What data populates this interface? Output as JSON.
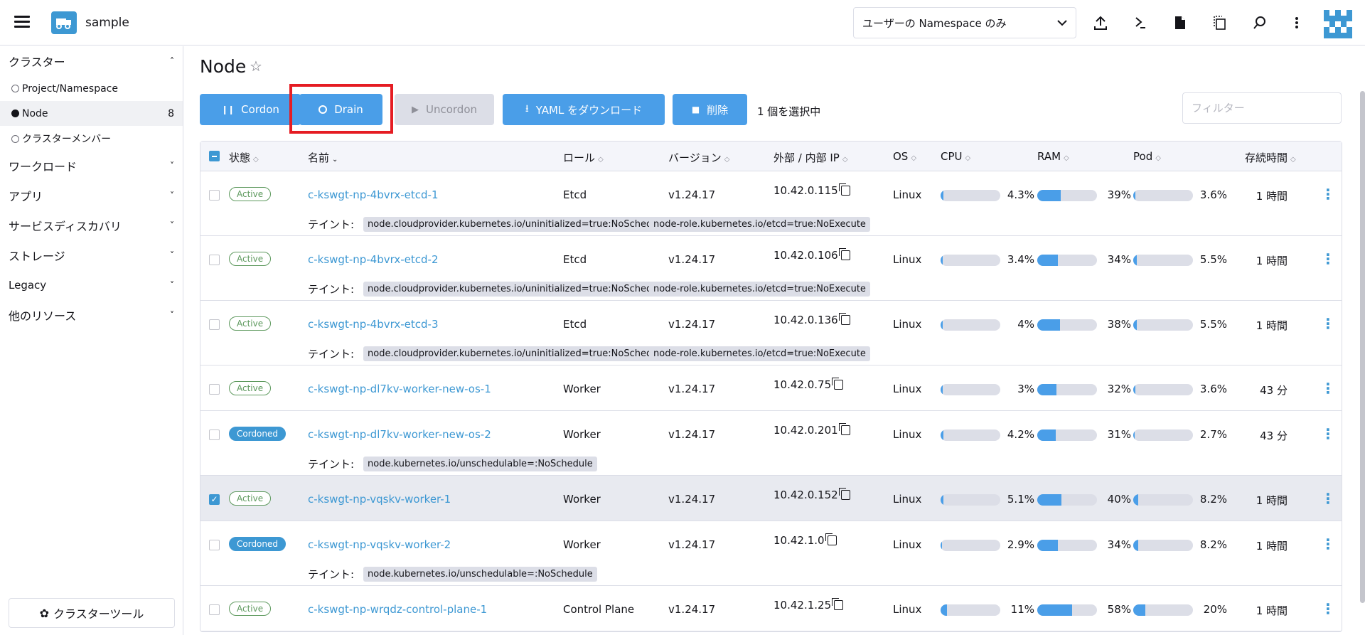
{
  "header": {
    "app_name": "sample",
    "namespace_select": "ユーザーの Namespace のみ"
  },
  "sidebar": {
    "groups": [
      {
        "label": "クラスター",
        "expanded": true
      },
      {
        "label": "ワークロード"
      },
      {
        "label": "アプリ"
      },
      {
        "label": "サービスディスカバリ"
      },
      {
        "label": "ストレージ"
      },
      {
        "label": "Legacy"
      },
      {
        "label": "他のリソース"
      }
    ],
    "cluster_items": [
      {
        "label": "Project/Namespace",
        "count": ""
      },
      {
        "label": "Node",
        "count": "8",
        "active": true
      },
      {
        "label": "クラスターメンバー",
        "count": ""
      }
    ],
    "cluster_tools": "クラスターツール"
  },
  "page": {
    "title": "Node",
    "buttons": {
      "cordon": "Cordon",
      "drain": "Drain",
      "uncordon": "Uncordon",
      "yaml": "YAML をダウンロード",
      "delete": "削除"
    },
    "selected_count": "1 個を選択中",
    "filter_placeholder": "フィルター"
  },
  "table": {
    "headers": {
      "state": "状態",
      "name": "名前",
      "role": "ロール",
      "version": "バージョン",
      "ip": "外部 / 内部 IP",
      "os": "OS",
      "cpu": "CPU",
      "ram": "RAM",
      "pod": "Pod",
      "age": "存続時間"
    },
    "taint_label": "テイント:",
    "rows": [
      {
        "state": "Active",
        "name": "c-kswgt-np-4bvrx-etcd-1",
        "role": "Etcd",
        "version": "v1.24.17",
        "ip": "10.42.0.115",
        "os": "Linux",
        "cpu": "4.3%",
        "cpu_v": 4.3,
        "ram": "39%",
        "ram_v": 39,
        "pod": "3.6%",
        "pod_v": 3.6,
        "age": "1 時間",
        "taints": [
          "node.cloudprovider.kubernetes.io/uninitialized=true:NoSchedule",
          "node-role.kubernetes.io/etcd=true:NoExecute"
        ],
        "checked": false
      },
      {
        "state": "Active",
        "name": "c-kswgt-np-4bvrx-etcd-2",
        "role": "Etcd",
        "version": "v1.24.17",
        "ip": "10.42.0.106",
        "os": "Linux",
        "cpu": "3.4%",
        "cpu_v": 3.4,
        "ram": "34%",
        "ram_v": 34,
        "pod": "5.5%",
        "pod_v": 5.5,
        "age": "1 時間",
        "taints": [
          "node.cloudprovider.kubernetes.io/uninitialized=true:NoSchedule",
          "node-role.kubernetes.io/etcd=true:NoExecute"
        ],
        "checked": false
      },
      {
        "state": "Active",
        "name": "c-kswgt-np-4bvrx-etcd-3",
        "role": "Etcd",
        "version": "v1.24.17",
        "ip": "10.42.0.136",
        "os": "Linux",
        "cpu": "4%",
        "cpu_v": 4,
        "ram": "38%",
        "ram_v": 38,
        "pod": "5.5%",
        "pod_v": 5.5,
        "age": "1 時間",
        "taints": [
          "node.cloudprovider.kubernetes.io/uninitialized=true:NoSchedule",
          "node-role.kubernetes.io/etcd=true:NoExecute"
        ],
        "checked": false
      },
      {
        "state": "Active",
        "name": "c-kswgt-np-dl7kv-worker-new-os-1",
        "role": "Worker",
        "version": "v1.24.17",
        "ip": "10.42.0.75",
        "os": "Linux",
        "cpu": "3%",
        "cpu_v": 3,
        "ram": "32%",
        "ram_v": 32,
        "pod": "3.6%",
        "pod_v": 3.6,
        "age": "43 分",
        "taints": [],
        "checked": false
      },
      {
        "state": "Cordoned",
        "name": "c-kswgt-np-dl7kv-worker-new-os-2",
        "role": "Worker",
        "version": "v1.24.17",
        "ip": "10.42.0.201",
        "os": "Linux",
        "cpu": "4.2%",
        "cpu_v": 4.2,
        "ram": "31%",
        "ram_v": 31,
        "pod": "2.7%",
        "pod_v": 2.7,
        "age": "43 分",
        "taints": [
          "node.kubernetes.io/unschedulable=:NoSchedule"
        ],
        "checked": false
      },
      {
        "state": "Active",
        "name": "c-kswgt-np-vqskv-worker-1",
        "role": "Worker",
        "version": "v1.24.17",
        "ip": "10.42.0.152",
        "os": "Linux",
        "cpu": "5.1%",
        "cpu_v": 5.1,
        "ram": "40%",
        "ram_v": 40,
        "pod": "8.2%",
        "pod_v": 8.2,
        "age": "1 時間",
        "taints": [],
        "checked": true
      },
      {
        "state": "Cordoned",
        "name": "c-kswgt-np-vqskv-worker-2",
        "role": "Worker",
        "version": "v1.24.17",
        "ip": "10.42.1.0",
        "os": "Linux",
        "cpu": "2.9%",
        "cpu_v": 2.9,
        "ram": "34%",
        "ram_v": 34,
        "pod": "8.2%",
        "pod_v": 8.2,
        "age": "1 時間",
        "taints": [
          "node.kubernetes.io/unschedulable=:NoSchedule"
        ],
        "checked": false
      },
      {
        "state": "Active",
        "name": "c-kswgt-np-wrqdz-control-plane-1",
        "role": "Control Plane",
        "version": "v1.24.17",
        "ip": "10.42.1.25",
        "os": "Linux",
        "cpu": "11%",
        "cpu_v": 11,
        "ram": "58%",
        "ram_v": 58,
        "pod": "20%",
        "pod_v": 20,
        "age": "1 時間",
        "taints": [],
        "checked": false
      }
    ]
  },
  "colors": {
    "primary": "#4a9ee8",
    "active_badge": "#5d995d",
    "highlight": "#e51c23"
  }
}
